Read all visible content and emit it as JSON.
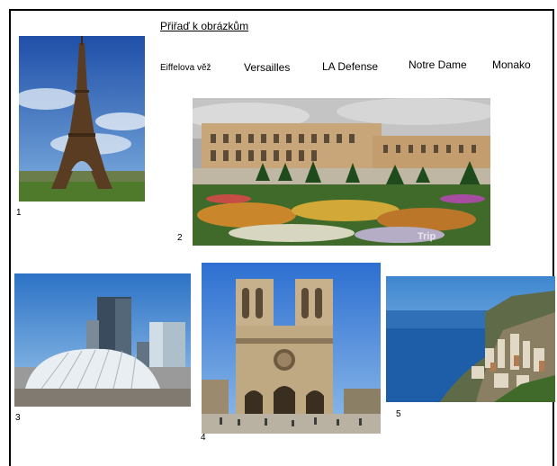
{
  "title": "Přiřaď k obrázkům",
  "options": [
    "Eiffelova věž",
    "Versailles",
    "LA Defense",
    "Notre Dame",
    "Monako"
  ],
  "numbers": [
    "1",
    "2",
    "3",
    "4",
    "5"
  ],
  "watermark": "Trip"
}
